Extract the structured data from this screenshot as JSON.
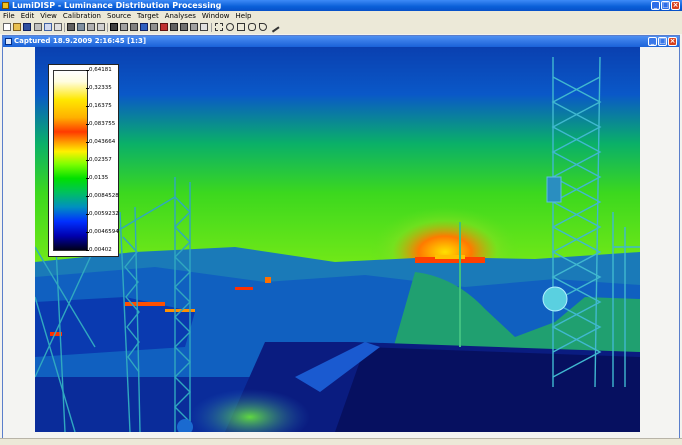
{
  "window": {
    "title": "LumiDISP - Luminance Distribution Processing",
    "controls": [
      "_",
      "□",
      "×"
    ]
  },
  "menu": [
    "File",
    "Edit",
    "View",
    "Calibration",
    "Source",
    "Target",
    "Analyses",
    "Window",
    "Help"
  ],
  "document": {
    "title": "Captured 18.9.2009 2:16:45 [1:3]",
    "controls": [
      "_",
      "□",
      "×"
    ]
  },
  "colors": {
    "title_blue": "#0a5fd8",
    "image_background": "#0a2c9a"
  },
  "scale": {
    "labels": [
      "0,64181",
      "0,32335",
      "0,16375",
      "0,083755",
      "0,043664",
      "0,02357",
      "0,0135",
      "0,0084528",
      "0,0059232",
      "0,0046594",
      "0,00402"
    ]
  }
}
